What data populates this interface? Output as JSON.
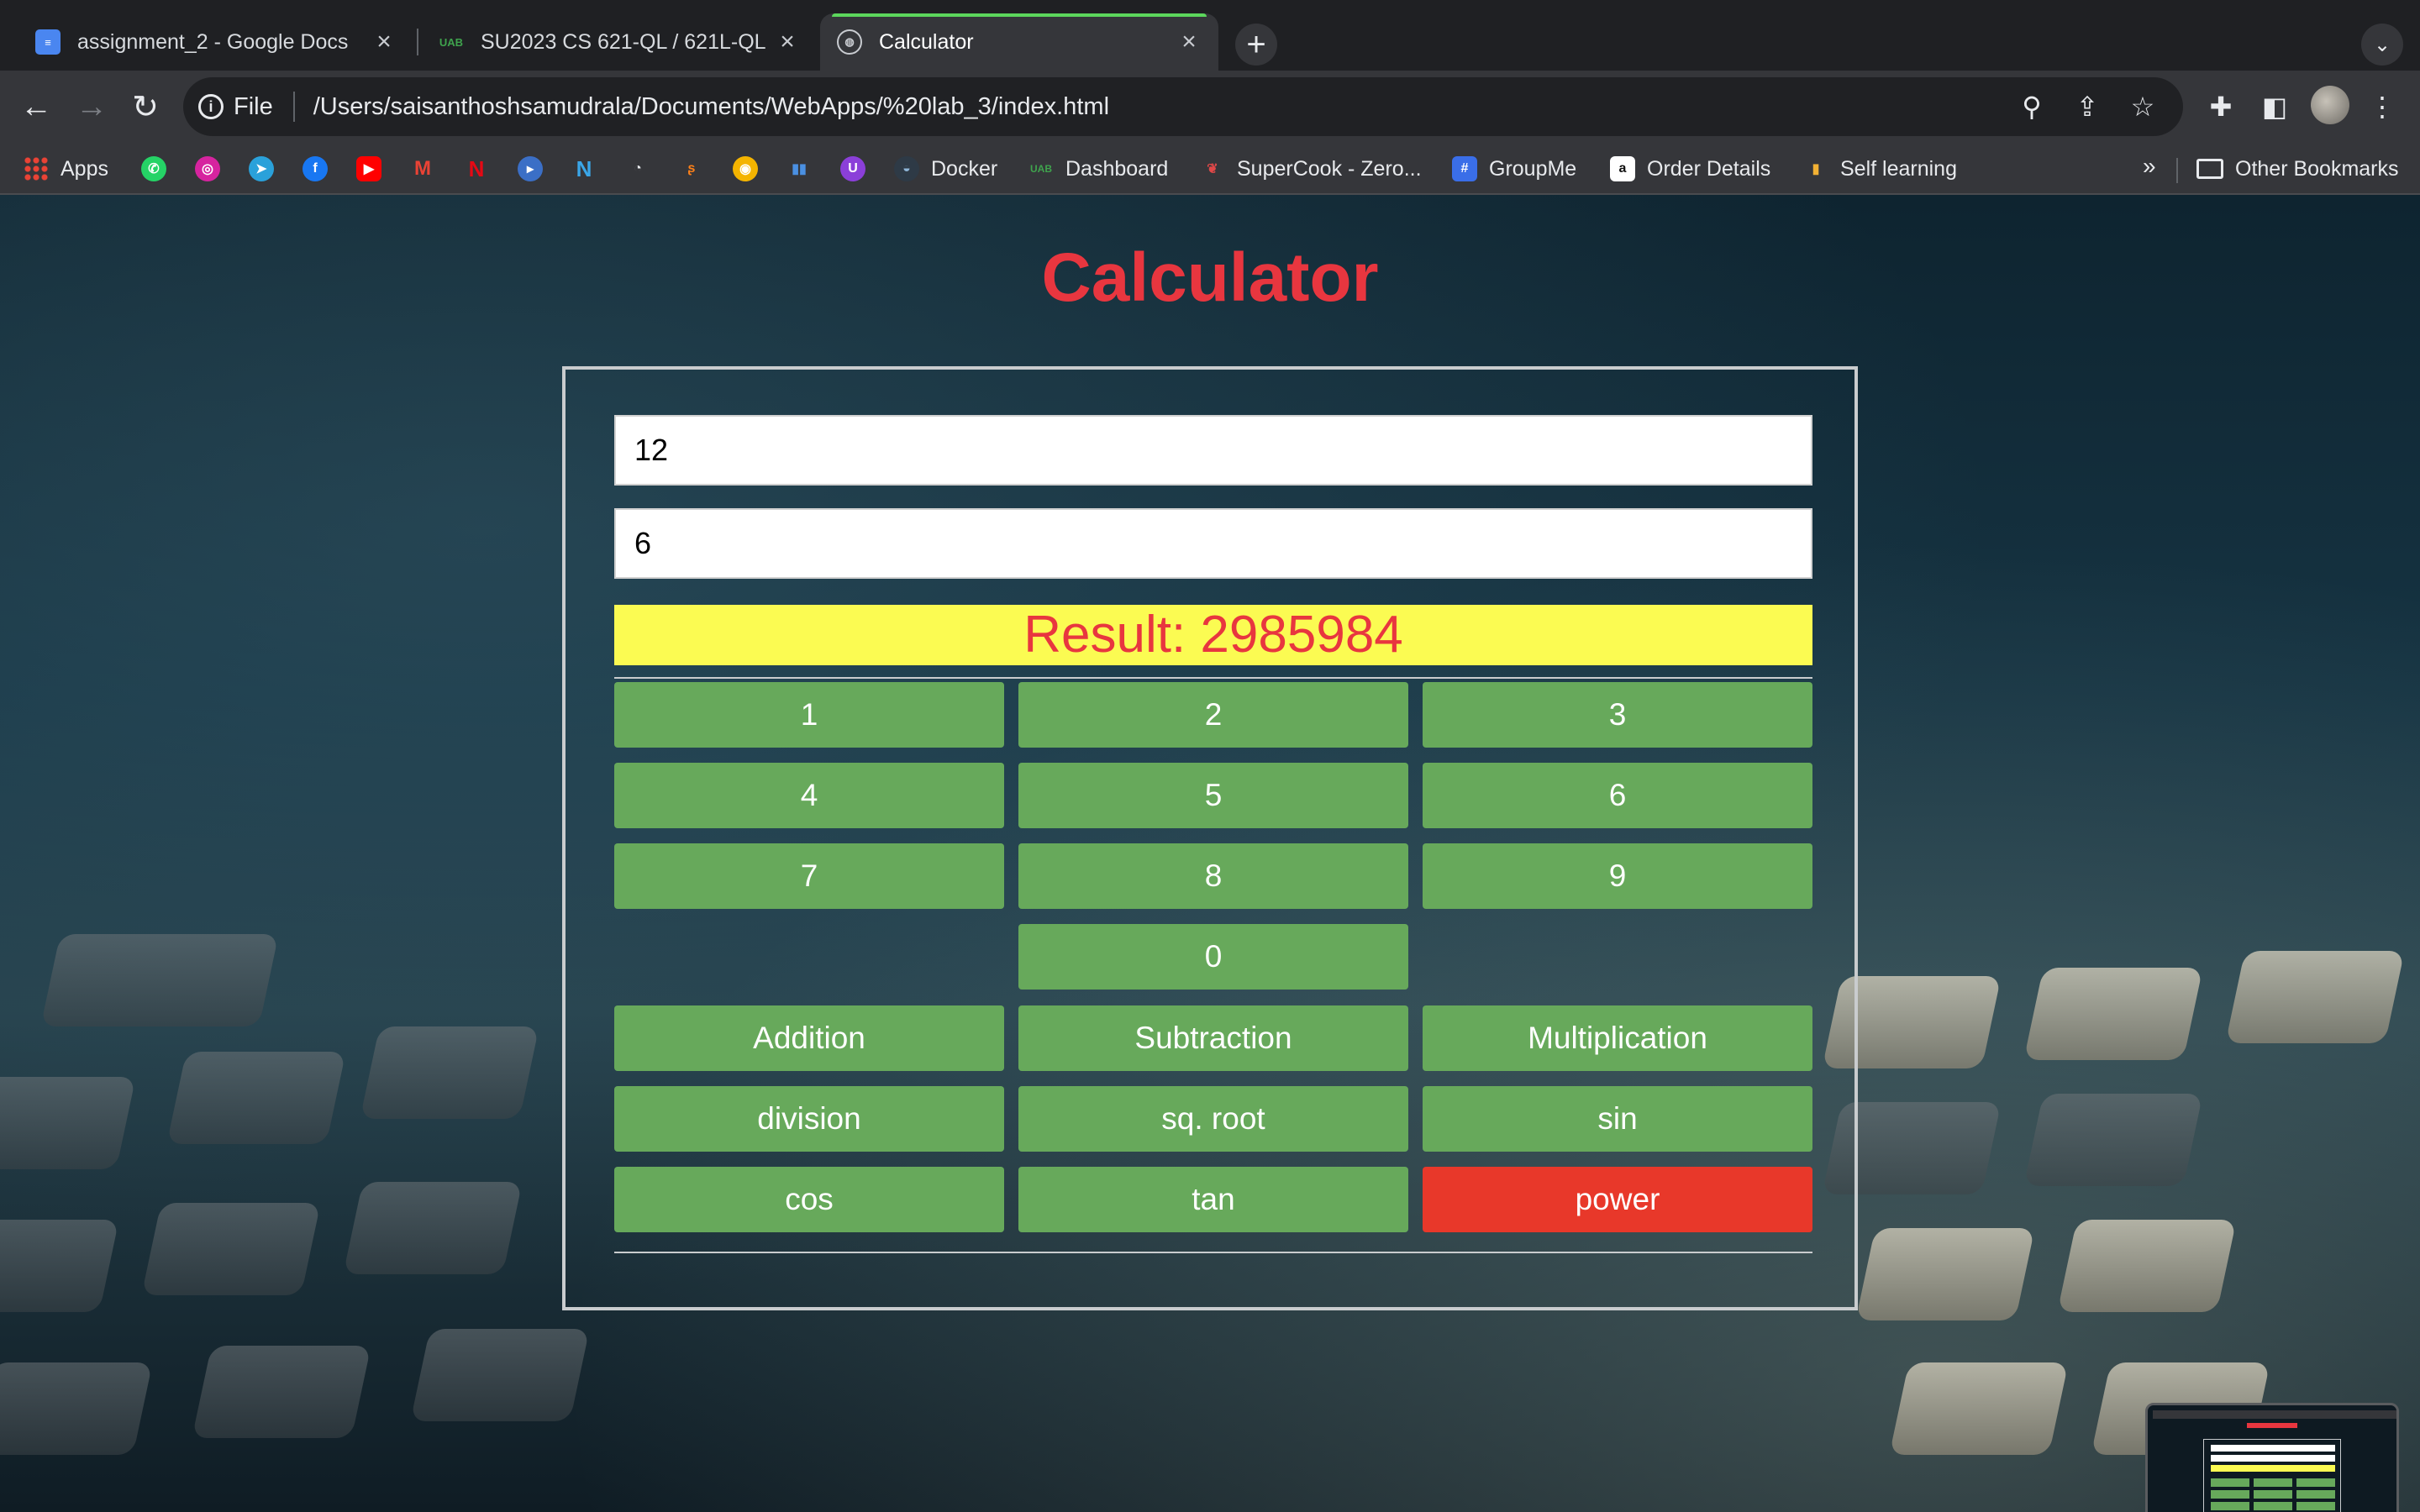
{
  "browser": {
    "tabs": [
      {
        "title": "assignment_2 - Google Docs",
        "favicon": "google-docs-icon",
        "active": false
      },
      {
        "title": "SU2023 CS 621-QL / 621L-QL",
        "favicon": "uab-icon",
        "active": false
      },
      {
        "title": "Calculator",
        "favicon": "globe-icon",
        "active": true
      }
    ],
    "address": {
      "scheme_label": "File",
      "url": "/Users/saisanthoshsamudrala/Documents/WebApps/%20lab_3/index.html"
    },
    "bookmarks": [
      {
        "label": "Apps",
        "icon": "apps-grid-icon"
      },
      {
        "label": "",
        "icon": "whatsapp-icon"
      },
      {
        "label": "",
        "icon": "instagram-icon"
      },
      {
        "label": "",
        "icon": "telegram-icon"
      },
      {
        "label": "",
        "icon": "facebook-icon"
      },
      {
        "label": "",
        "icon": "youtube-icon"
      },
      {
        "label": "",
        "icon": "gmail-icon"
      },
      {
        "label": "",
        "icon": "netflix-icon"
      },
      {
        "label": "",
        "icon": "play-icon"
      },
      {
        "label": "",
        "icon": "n-icon"
      },
      {
        "label": "",
        "icon": "speedometer-icon"
      },
      {
        "label": "",
        "icon": "swiggy-icon"
      },
      {
        "label": "",
        "icon": "circle-logo-icon"
      },
      {
        "label": "",
        "icon": "bars-logo-icon"
      },
      {
        "label": "",
        "icon": "u-logo-icon"
      },
      {
        "label": "Docker",
        "icon": "docker-icon"
      },
      {
        "label": "Dashboard",
        "icon": "uab-icon"
      },
      {
        "label": "SuperCook - Zero...",
        "icon": "supercook-icon"
      },
      {
        "label": "GroupMe",
        "icon": "groupme-icon"
      },
      {
        "label": "Order Details",
        "icon": "amazon-icon"
      },
      {
        "label": "Self learning",
        "icon": "bar-chart-icon"
      }
    ],
    "bookmarks_overflow": "»",
    "other_bookmarks": "Other Bookmarks"
  },
  "page": {
    "title": "Calculator",
    "inputs": {
      "first_value": "12",
      "second_value": "6"
    },
    "result_text": "Result: 2985984",
    "digit_buttons": [
      "1",
      "2",
      "3",
      "4",
      "5",
      "6",
      "7",
      "8",
      "9",
      "0"
    ],
    "operation_buttons": [
      "Addition",
      "Subtraction",
      "Multiplication",
      "division",
      "sq. root",
      "sin",
      "cos",
      "tan",
      "power"
    ],
    "colors": {
      "title": "#e8363f",
      "button": "#67a95b",
      "power_button": "#e8382a",
      "result_background": "#fbfb52",
      "result_text": "#e8363f"
    }
  }
}
